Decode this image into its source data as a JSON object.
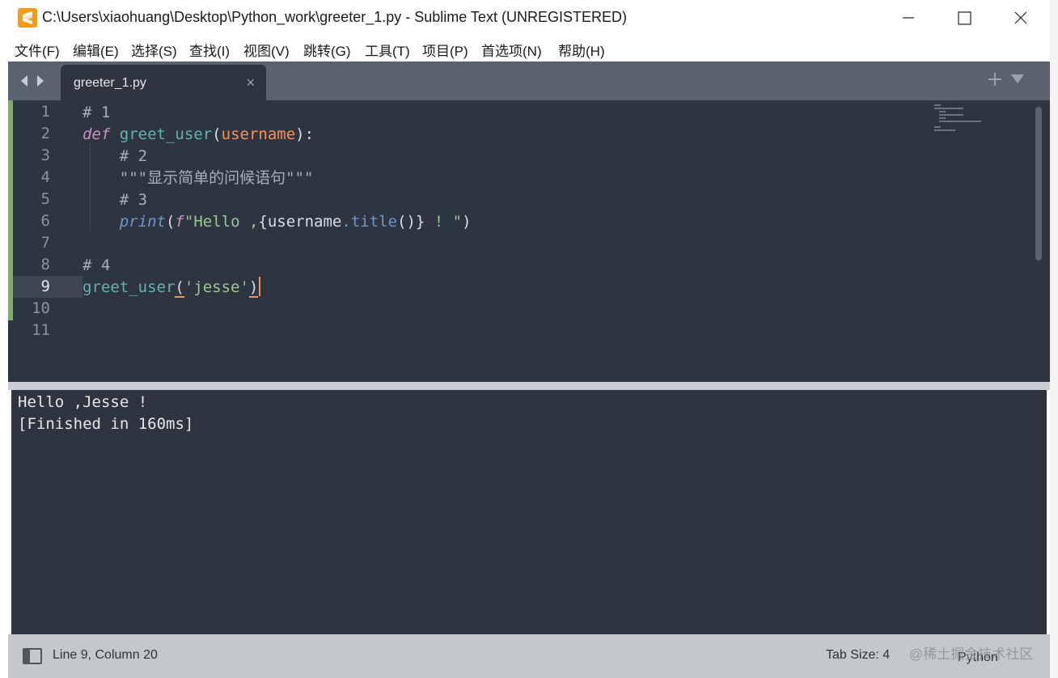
{
  "window": {
    "title": "C:\\Users\\xiaohuang\\Desktop\\Python_work\\greeter_1.py - Sublime Text (UNREGISTERED)"
  },
  "menu": [
    {
      "label": "文件(F)"
    },
    {
      "label": "编辑(E)"
    },
    {
      "label": "选择(S)"
    },
    {
      "label": "查找(I)"
    },
    {
      "label": "视图(V)"
    },
    {
      "label": "跳转(G)"
    },
    {
      "label": "工具(T)"
    },
    {
      "label": "项目(P)"
    },
    {
      "label": "首选项(N)"
    },
    {
      "label": "帮助(H)"
    }
  ],
  "tab": {
    "filename": "greeter_1.py",
    "close_symbol": "×"
  },
  "editor": {
    "line_numbers": [
      "1",
      "2",
      "3",
      "4",
      "5",
      "6",
      "7",
      "8",
      "9",
      "10",
      "11"
    ],
    "current_line": "9",
    "code": {
      "l1": "# 1",
      "l2_kw": "def",
      "l2_fn": "greet_user",
      "l2_open": "(",
      "l2_param": "username",
      "l2_close": "):",
      "l3": "    # 2",
      "l4": "    \"\"\"显示简单的问候语句\"\"\"",
      "l5": "    # 3",
      "l6_indent": "    ",
      "l6_print": "print",
      "l6_open": "(",
      "l6_f": "f",
      "l6_str1": "\"Hello ,",
      "l6_brace_open": "{",
      "l6_var": "username",
      "l6_dot": ".",
      "l6_meth": "title",
      "l6_call": "()",
      "l6_brace_close": "}",
      "l6_str2": " ! \"",
      "l6_close": ")",
      "l8": "# 4",
      "l9_fn": "greet_user",
      "l9_open": "(",
      "l9_str": "'jesse'",
      "l9_close": ")"
    }
  },
  "output": {
    "lines": [
      "Hello ,Jesse !",
      "[Finished in 160ms]"
    ]
  },
  "status": {
    "position": "Line 9, Column 20",
    "tab_size": "Tab Size: 4",
    "syntax": "Python"
  },
  "watermark": "@稀土掘金技术社区",
  "colors": {
    "editor_bg": "#2f3540",
    "tabbar_bg": "#5c6370",
    "accent_orange": "#f99157",
    "string_green": "#99c794",
    "keyword_purple": "#c594c5",
    "function_teal": "#5fb3b3"
  }
}
